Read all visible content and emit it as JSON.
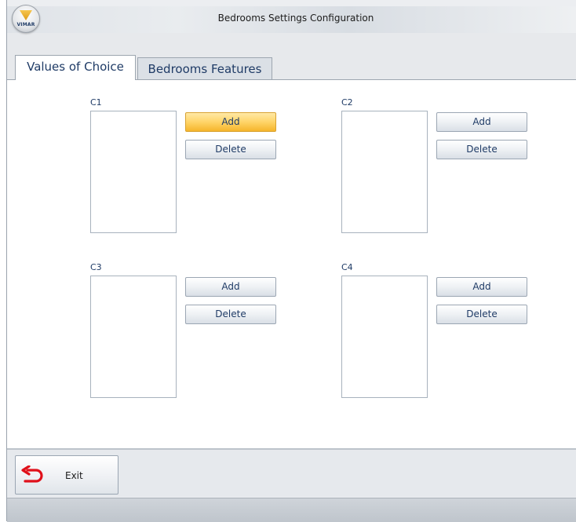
{
  "window": {
    "title": "Bedrooms Settings Configuration",
    "logo_text": "VIMAR"
  },
  "tabs": [
    {
      "label": "Values of Choice",
      "active": true
    },
    {
      "label": "Bedrooms Features",
      "active": false
    }
  ],
  "groups": [
    {
      "label": "C1",
      "add_label": "Add",
      "delete_label": "Delete"
    },
    {
      "label": "C2",
      "add_label": "Add",
      "delete_label": "Delete"
    },
    {
      "label": "C3",
      "add_label": "Add",
      "delete_label": "Delete"
    },
    {
      "label": "C4",
      "add_label": "Add",
      "delete_label": "Delete"
    }
  ],
  "footer": {
    "exit_label": "Exit",
    "exit_icon": "return-arrow-icon"
  },
  "colors": {
    "accent_text": "#1f3b66",
    "hover_button": "#ffd468",
    "exit_icon": "#e0101a"
  }
}
